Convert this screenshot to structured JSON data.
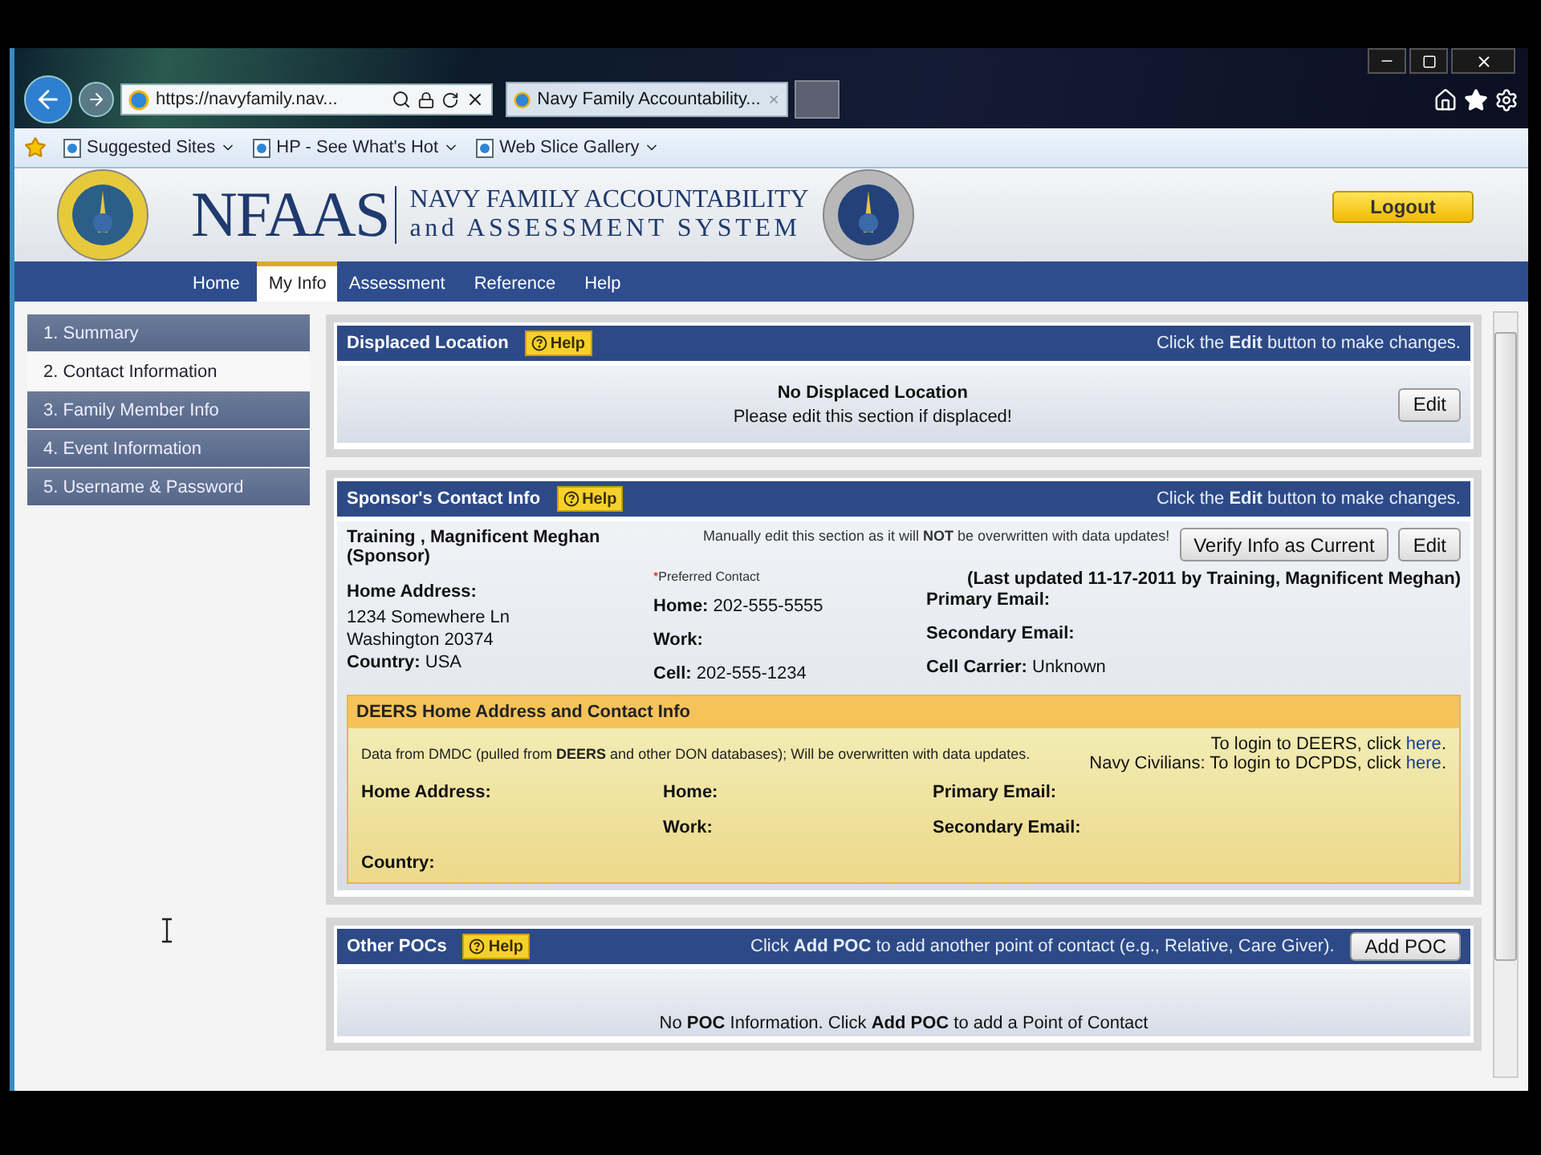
{
  "browser": {
    "address": "https://navyfamily.nav...",
    "tab_title": "Navy Family Accountability...",
    "favorites": [
      "Suggested Sites",
      "HP - See What's Hot",
      "Web Slice Gallery"
    ]
  },
  "site": {
    "logo_text": "NFAAS",
    "title_line1": "NAVY FAMILY ACCOUNTABILITY",
    "title_line2": "and ASSESSMENT SYSTEM",
    "logout": "Logout"
  },
  "nav": [
    {
      "label": "Home",
      "selected": false
    },
    {
      "label": "My Info",
      "selected": true
    },
    {
      "label": "Assessment",
      "selected": false
    },
    {
      "label": "Reference",
      "selected": false
    },
    {
      "label": "Help",
      "selected": false
    }
  ],
  "sidebar": [
    {
      "label": "1. Summary",
      "selected": false
    },
    {
      "label": "2. Contact Information",
      "selected": true
    },
    {
      "label": "3. Family Member Info",
      "selected": false
    },
    {
      "label": "4. Event Information",
      "selected": false
    },
    {
      "label": "5. Username & Password",
      "selected": false
    }
  ],
  "displaced": {
    "title": "Displaced Location",
    "help": "Help",
    "hint": "Click the **Edit** button to make changes.",
    "heading": "No Displaced Location",
    "message": "Please edit this section if displaced!",
    "button": "Edit"
  },
  "sponsor": {
    "title": "Sponsor's Contact Info",
    "help": "Help",
    "hint": "Click the **Edit** button to make changes.",
    "name": "Training ,  Magnificent  Meghan (Sponsor)",
    "notice": "Manually edit this section as it will **NOT** be overwritten with data updates!",
    "buttons": [
      "Verify Info as Current",
      "Edit"
    ],
    "updated": "(Last updated 11-17-2011 by Training, Magnificent Meghan)",
    "preferred": {
      "mark": "*",
      "text": "Preferred Contact"
    },
    "address": {
      "label": "Home Address:",
      "lines": [
        "1234 Somewhere Ln",
        "Washington   20374"
      ],
      "country_label": "Country:",
      "country": "USA"
    },
    "phones": [
      {
        "label": "Home:",
        "value": "202-555-5555"
      },
      {
        "label": "Work:"
      },
      {
        "label": "Cell:",
        "value": "202-555-1234"
      }
    ],
    "emails": [
      {
        "label": "Primary Email:"
      },
      {
        "label": "Secondary Email:"
      },
      {
        "label": "Cell Carrier:",
        "value": "Unknown"
      }
    ]
  },
  "deers": {
    "title": "DEERS Home Address and Contact Info",
    "note": "Data from DMDC (pulled from **DEERS** and other DON databases); Will be overwritten with data updates.",
    "logins": [
      {
        "text": "To login to DEERS, click ",
        "link": "here",
        "end": "."
      },
      {
        "text": "Navy Civilians: To login to DCPDS, click ",
        "link": "here",
        "end": "."
      }
    ],
    "fields": [
      "Home Address:",
      "Home:",
      "Primary Email:",
      "Work:",
      "Secondary Email:",
      "Country:"
    ]
  },
  "pocs": {
    "title": "Other POCs",
    "help": "Help",
    "hint": "Click **Add POC** to add another point of contact (e.g., Relative, Care Giver).",
    "button": "Add POC",
    "empty": "No **POC** Information. Click **Add POC** to add a Point of Contact"
  }
}
